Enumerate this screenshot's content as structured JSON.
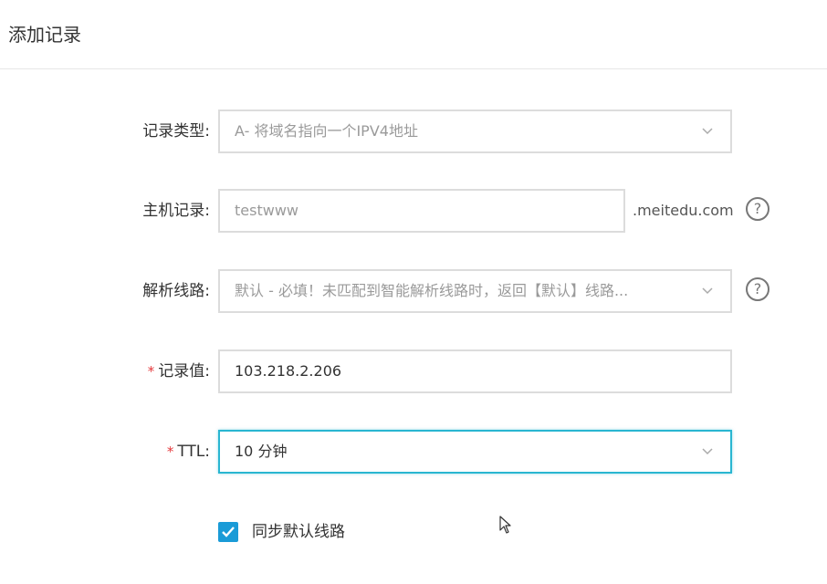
{
  "header": {
    "title": "添加记录"
  },
  "form": {
    "record_type": {
      "label": "记录类型:",
      "value": "A- 将域名指向一个IPV4地址",
      "icon": "chevron-down-icon"
    },
    "host": {
      "label": "主机记录:",
      "value": "testwww",
      "suffix": ".meitedu.com",
      "help": "?"
    },
    "line": {
      "label": "解析线路:",
      "value": "默认 - 必填！未匹配到智能解析线路时，返回【默认】线路...",
      "help": "?"
    },
    "record_value": {
      "required_mark": "*",
      "label": "记录值:",
      "value": "103.218.2.206"
    },
    "ttl": {
      "required_mark": "*",
      "label": "TTL:",
      "value": "10 分钟"
    },
    "sync": {
      "label": "同步默认线路",
      "checked": true
    }
  },
  "colors": {
    "accent": "#1a9bd7",
    "focus": "#29b6d1",
    "required": "#e4393c"
  }
}
